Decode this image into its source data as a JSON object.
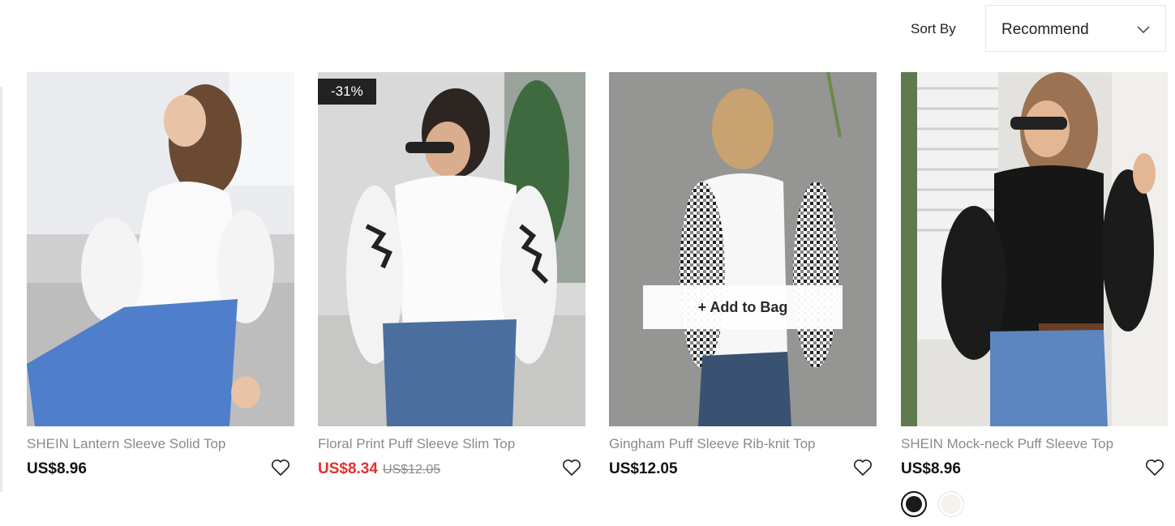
{
  "sort": {
    "label": "Sort By",
    "value": "Recommend"
  },
  "products": [
    {
      "title": "SHEIN Lantern Sleeve Solid Top",
      "price": "US$8.96"
    },
    {
      "title": "Floral Print Puff Sleeve Slim Top",
      "price": "US$8.34",
      "original_price": "US$12.05",
      "badge": "-31%"
    },
    {
      "title": "Gingham Puff Sleeve Rib-knit Top",
      "price": "US$12.05",
      "hover_action": "+ Add to Bag"
    },
    {
      "title": "SHEIN Mock-neck Puff Sleeve Top",
      "price": "US$8.96",
      "swatch_colors": [
        "#1a1a1a",
        "#f5f1ec"
      ]
    }
  ],
  "colors": {
    "sale_price": "#e4302f",
    "badge_bg": "#222222"
  },
  "icons": {
    "wishlist": "heart-outline-icon",
    "sort_dropdown": "chevron-down-icon"
  }
}
